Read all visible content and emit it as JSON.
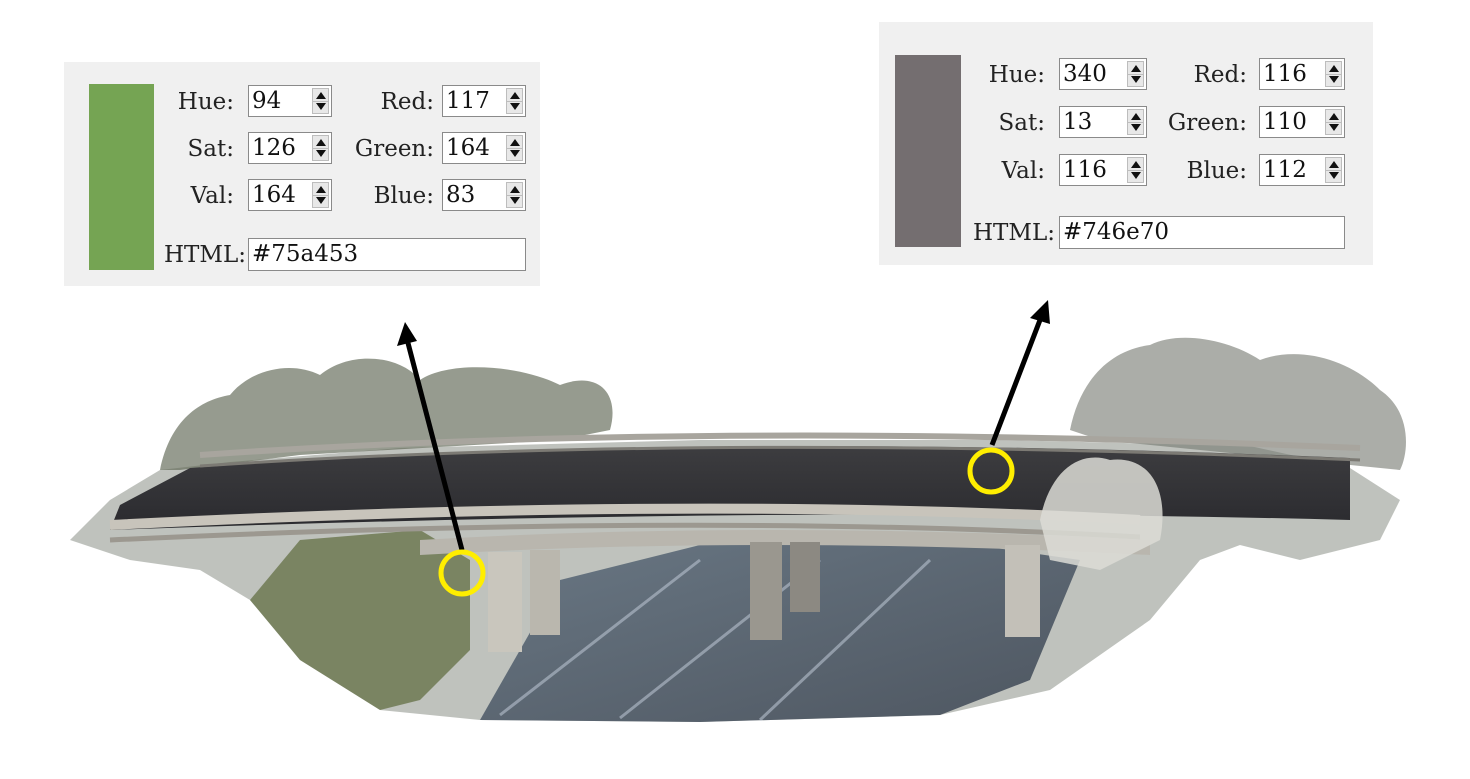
{
  "pickers": [
    {
      "swatch_color": "#75a453",
      "hue_label": "Hue:",
      "hue": "94",
      "sat_label": "Sat:",
      "sat": "126",
      "val_label": "Val:",
      "val": "164",
      "red_label": "Red:",
      "red": "117",
      "green_label": "Green:",
      "green": "164",
      "blue_label": "Blue:",
      "blue": "83",
      "html_label": "HTML:",
      "html": "#75a453"
    },
    {
      "swatch_color": "#746e70",
      "hue_label": "Hue:",
      "hue": "340",
      "sat_label": "Sat:",
      "sat": "13",
      "val_label": "Val:",
      "val": "116",
      "red_label": "Red:",
      "red": "116",
      "green_label": "Green:",
      "green": "110",
      "blue_label": "Blue:",
      "blue": "112",
      "html_label": "HTML:",
      "html": "#746e70"
    }
  ],
  "scene": {
    "marker_color": "#ffee00",
    "arrow_color": "#000000",
    "image_description_icon": "bridge-point-cloud-image"
  }
}
